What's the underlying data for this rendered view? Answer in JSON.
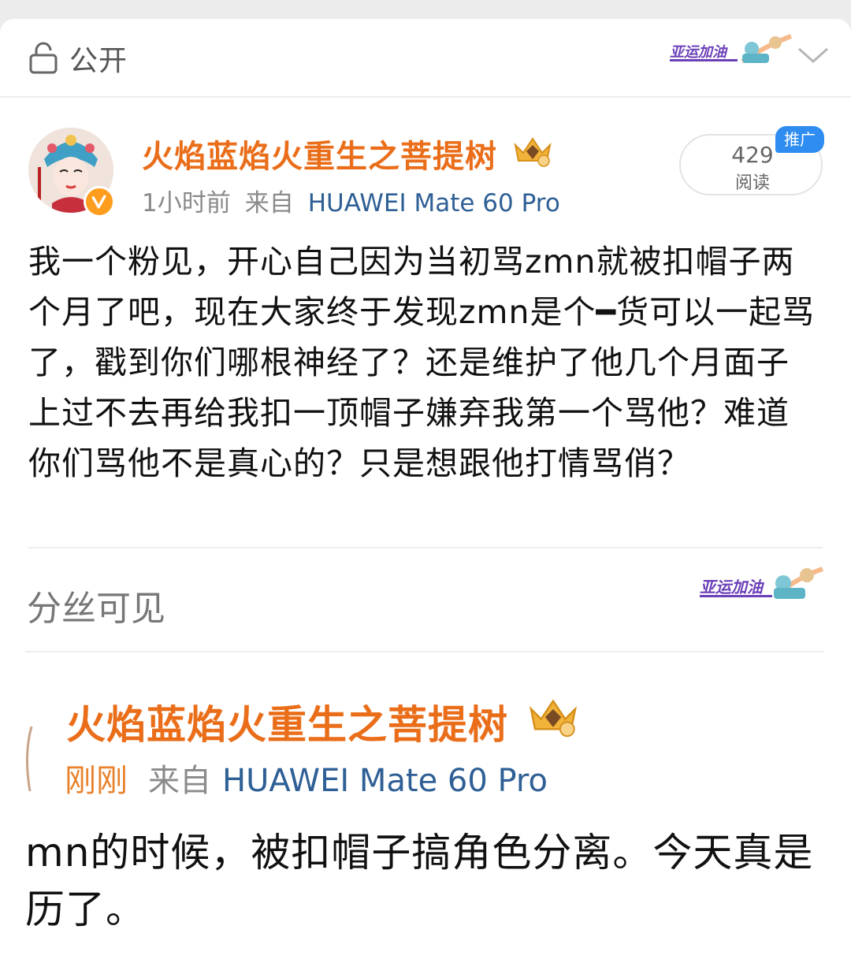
{
  "header": {
    "visibility_label": "公开",
    "badge_text": "亚运加油"
  },
  "post": {
    "author": "火焰蓝焰火重生之菩提树",
    "time": "1小时前",
    "from_label": "来自",
    "device": "HUAWEI Mate 60 Pro",
    "reads_count": "429",
    "reads_label": "阅读",
    "promo_badge": "推广",
    "content": "我一个粉见，开心自己因为当初骂zmn就被扣帽子两个月了吧，现在大家终于发现zmn是个━货可以一起骂了，戳到你们哪根神经了？还是维护了他几个月面子上过不去再给我扣一顶帽子嫌弃我第一个骂他？难道你们骂他不是真心的？只是想跟他打情骂俏？"
  },
  "section": {
    "fans_visible_label": "分丝可见",
    "badge_text": "亚运加油"
  },
  "quoted": {
    "author": "火焰蓝焰火重生之菩提树",
    "time": "刚刚",
    "from_label": "来自",
    "device": "HUAWEI Mate 60 Pro",
    "line1": "mn的时候，被扣帽子搞角色分离。今天真是",
    "line2": "历了。"
  },
  "colors": {
    "author": "#ea6e1a",
    "device": "#2e5f95",
    "promo": "#2f8cf0",
    "vip_badge": "#ff9d1e"
  },
  "icons": [
    "lock-icon",
    "chevron-down-icon",
    "crown-icon",
    "verified-icon"
  ]
}
